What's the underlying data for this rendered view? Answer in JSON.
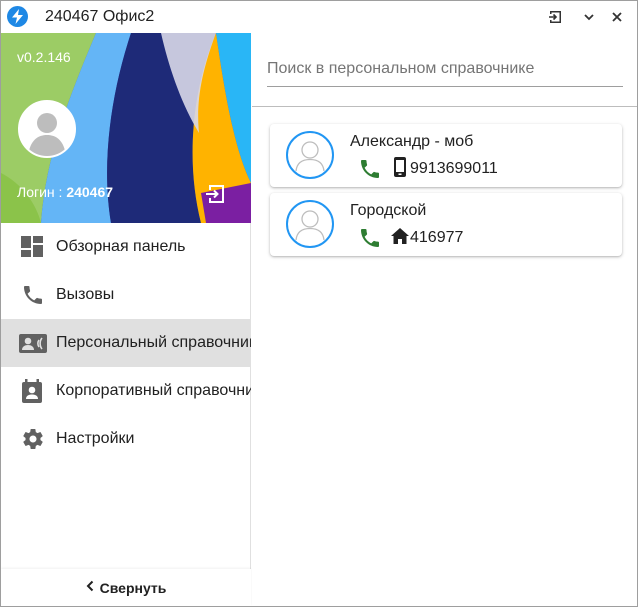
{
  "window": {
    "title": "240467 Офис2",
    "icons": [
      "bolt-icon",
      "logout-icon",
      "chevron-down-icon",
      "close-icon"
    ]
  },
  "sidebar": {
    "version": "v0.2.146",
    "login_label": "Логин : ",
    "login_value": "240467",
    "items": [
      {
        "label": "Обзорная панель",
        "icon": "dashboard-icon",
        "active": false
      },
      {
        "label": "Вызовы",
        "icon": "phone-icon",
        "active": false
      },
      {
        "label": "Персональный справочник",
        "icon": "contacts-icon",
        "active": true
      },
      {
        "label": "Корпоративный справочник",
        "icon": "contact-book-icon",
        "active": false
      },
      {
        "label": "Настройки",
        "icon": "gear-icon",
        "active": false
      }
    ],
    "collapse_label": "Свернуть"
  },
  "main": {
    "search": {
      "placeholder": "Поиск в персональном справочнике",
      "value": ""
    },
    "contacts": [
      {
        "name": "Александр - моб",
        "phone_type": "mobile-icon",
        "number": "9913699011"
      },
      {
        "name": "Городской",
        "phone_type": "home-icon",
        "number": "416977"
      }
    ]
  },
  "colors": {
    "accent": "#1e88e5",
    "avatar_ring": "#2196f3",
    "call_green": "#2e7d32",
    "active_item_bg": "#e0e0e0"
  }
}
